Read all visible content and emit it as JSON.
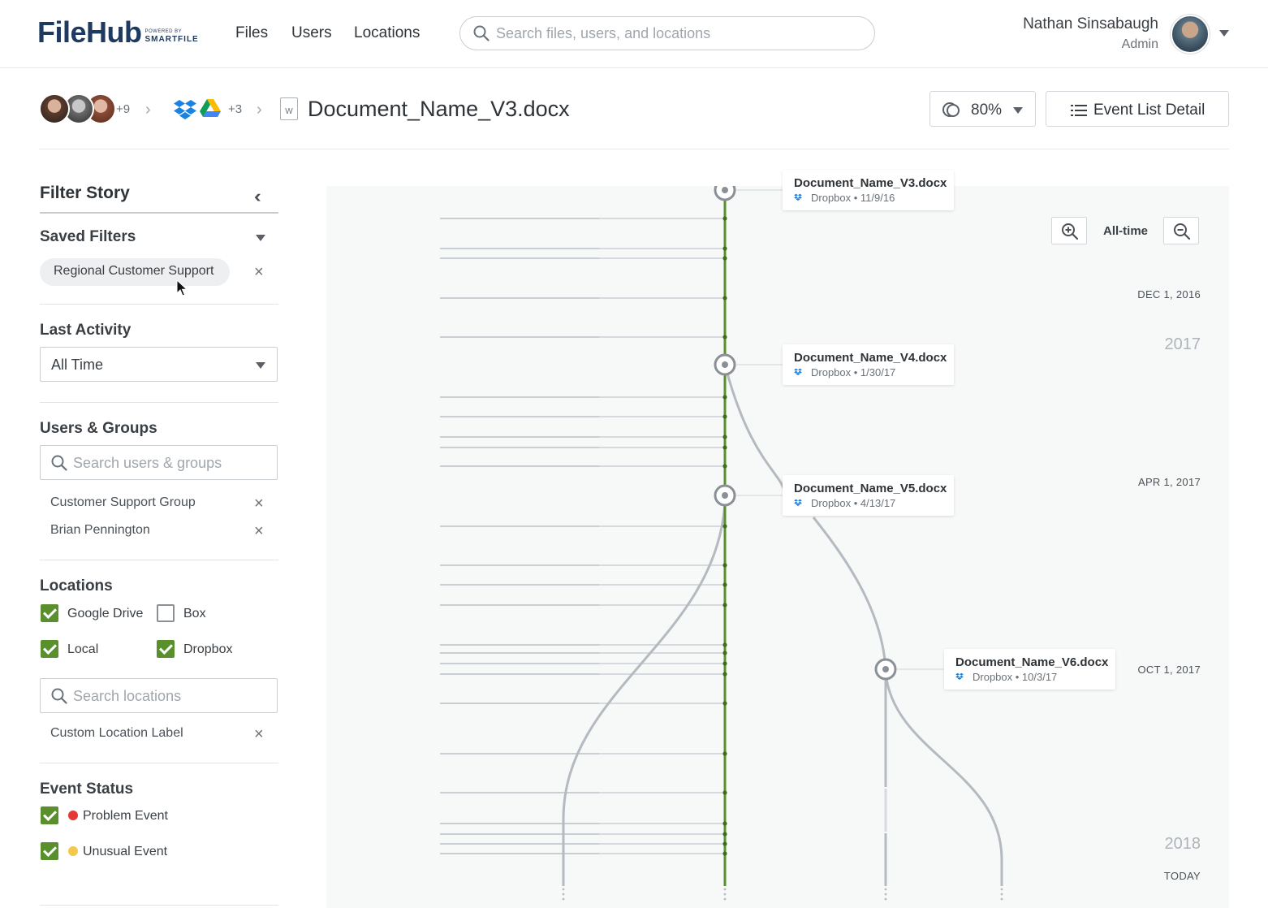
{
  "brand": {
    "name": "FileHub",
    "powered_by": "POWERED BY",
    "sub": "SMARTFILE"
  },
  "nav": {
    "links": [
      "Files",
      "Users",
      "Locations"
    ]
  },
  "search": {
    "placeholder": "Search files, users, and locations"
  },
  "user": {
    "name": "Nathan Sinsabaugh",
    "role": "Admin"
  },
  "breadcrumb": {
    "users_extra": "+9",
    "locations_extra": "+3",
    "file_icon_label": "W",
    "file_name": "Document_Name_V3.docx"
  },
  "toolbar": {
    "zoom_value": "80%",
    "event_list_label": "Event List Detail"
  },
  "sidebar": {
    "title": "Filter Story",
    "saved_filters": {
      "heading": "Saved Filters",
      "chip": "Regional Customer Support"
    },
    "last_activity": {
      "heading": "Last Activity",
      "value": "All Time"
    },
    "users_groups": {
      "heading": "Users & Groups",
      "placeholder": "Search users & groups",
      "items": [
        "Customer Support Group",
        "Brian Pennington"
      ]
    },
    "locations": {
      "heading": "Locations",
      "options": [
        {
          "label": "Google Drive",
          "checked": true
        },
        {
          "label": "Box",
          "checked": false
        },
        {
          "label": "Local",
          "checked": true
        },
        {
          "label": "Dropbox",
          "checked": true
        }
      ],
      "placeholder": "Search locations",
      "items": [
        "Custom Location Label"
      ]
    },
    "event_status": {
      "heading": "Event Status",
      "options": [
        {
          "label": "Problem Event",
          "checked": true,
          "color": "#e53935"
        },
        {
          "label": "Unusual Event",
          "checked": true,
          "color": "#f2c94c"
        }
      ]
    }
  },
  "timeline": {
    "range_label": "All-time",
    "dates": [
      "DEC 1, 2016",
      "APR 1, 2017",
      "OCT 1, 2017",
      "TODAY"
    ],
    "years": [
      "2017",
      "2018"
    ],
    "versions": [
      {
        "name": "Document_Name_V3.docx",
        "meta": "Dropbox • 11/9/16"
      },
      {
        "name": "Document_Name_V4.docx",
        "meta": "Dropbox • 1/30/17"
      },
      {
        "name": "Document_Name_V5.docx",
        "meta": "Dropbox • 4/13/17"
      },
      {
        "name": "Document_Name_V6.docx",
        "meta": "Dropbox • 10/3/17"
      }
    ]
  },
  "colors": {
    "accent": "#5a8f2e",
    "brand": "#1f3a5f",
    "problem": "#e53935",
    "unusual": "#f2c94c"
  },
  "icons": [
    "search-icon",
    "chevron-down-icon",
    "chevron-right-icon",
    "double-chevron-left-icon",
    "close-icon",
    "checkbox-icon",
    "list-icon",
    "zoom-in-icon",
    "zoom-out-icon",
    "dropbox-icon",
    "google-drive-icon",
    "word-doc-icon"
  ]
}
